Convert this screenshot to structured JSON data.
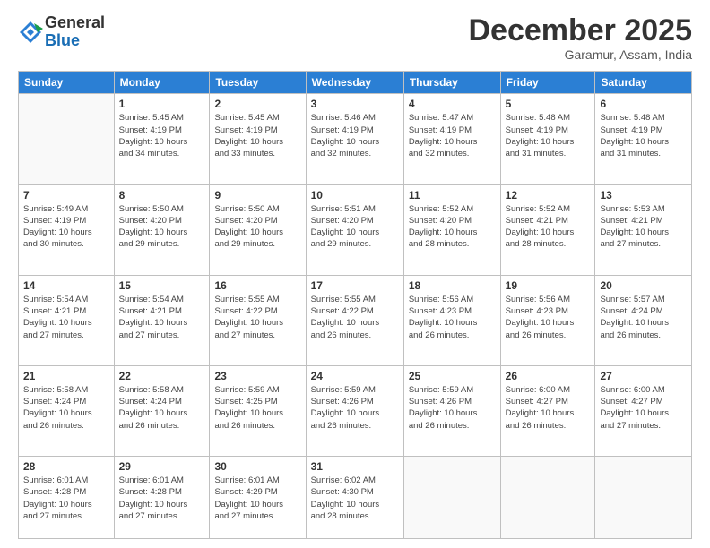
{
  "logo": {
    "general": "General",
    "blue": "Blue"
  },
  "header": {
    "month": "December 2025",
    "location": "Garamur, Assam, India"
  },
  "weekdays": [
    "Sunday",
    "Monday",
    "Tuesday",
    "Wednesday",
    "Thursday",
    "Friday",
    "Saturday"
  ],
  "weeks": [
    [
      {
        "day": "",
        "info": ""
      },
      {
        "day": "1",
        "info": "Sunrise: 5:45 AM\nSunset: 4:19 PM\nDaylight: 10 hours\nand 34 minutes."
      },
      {
        "day": "2",
        "info": "Sunrise: 5:45 AM\nSunset: 4:19 PM\nDaylight: 10 hours\nand 33 minutes."
      },
      {
        "day": "3",
        "info": "Sunrise: 5:46 AM\nSunset: 4:19 PM\nDaylight: 10 hours\nand 32 minutes."
      },
      {
        "day": "4",
        "info": "Sunrise: 5:47 AM\nSunset: 4:19 PM\nDaylight: 10 hours\nand 32 minutes."
      },
      {
        "day": "5",
        "info": "Sunrise: 5:48 AM\nSunset: 4:19 PM\nDaylight: 10 hours\nand 31 minutes."
      },
      {
        "day": "6",
        "info": "Sunrise: 5:48 AM\nSunset: 4:19 PM\nDaylight: 10 hours\nand 31 minutes."
      }
    ],
    [
      {
        "day": "7",
        "info": "Sunrise: 5:49 AM\nSunset: 4:19 PM\nDaylight: 10 hours\nand 30 minutes."
      },
      {
        "day": "8",
        "info": "Sunrise: 5:50 AM\nSunset: 4:20 PM\nDaylight: 10 hours\nand 29 minutes."
      },
      {
        "day": "9",
        "info": "Sunrise: 5:50 AM\nSunset: 4:20 PM\nDaylight: 10 hours\nand 29 minutes."
      },
      {
        "day": "10",
        "info": "Sunrise: 5:51 AM\nSunset: 4:20 PM\nDaylight: 10 hours\nand 29 minutes."
      },
      {
        "day": "11",
        "info": "Sunrise: 5:52 AM\nSunset: 4:20 PM\nDaylight: 10 hours\nand 28 minutes."
      },
      {
        "day": "12",
        "info": "Sunrise: 5:52 AM\nSunset: 4:21 PM\nDaylight: 10 hours\nand 28 minutes."
      },
      {
        "day": "13",
        "info": "Sunrise: 5:53 AM\nSunset: 4:21 PM\nDaylight: 10 hours\nand 27 minutes."
      }
    ],
    [
      {
        "day": "14",
        "info": "Sunrise: 5:54 AM\nSunset: 4:21 PM\nDaylight: 10 hours\nand 27 minutes."
      },
      {
        "day": "15",
        "info": "Sunrise: 5:54 AM\nSunset: 4:21 PM\nDaylight: 10 hours\nand 27 minutes."
      },
      {
        "day": "16",
        "info": "Sunrise: 5:55 AM\nSunset: 4:22 PM\nDaylight: 10 hours\nand 27 minutes."
      },
      {
        "day": "17",
        "info": "Sunrise: 5:55 AM\nSunset: 4:22 PM\nDaylight: 10 hours\nand 26 minutes."
      },
      {
        "day": "18",
        "info": "Sunrise: 5:56 AM\nSunset: 4:23 PM\nDaylight: 10 hours\nand 26 minutes."
      },
      {
        "day": "19",
        "info": "Sunrise: 5:56 AM\nSunset: 4:23 PM\nDaylight: 10 hours\nand 26 minutes."
      },
      {
        "day": "20",
        "info": "Sunrise: 5:57 AM\nSunset: 4:24 PM\nDaylight: 10 hours\nand 26 minutes."
      }
    ],
    [
      {
        "day": "21",
        "info": "Sunrise: 5:58 AM\nSunset: 4:24 PM\nDaylight: 10 hours\nand 26 minutes."
      },
      {
        "day": "22",
        "info": "Sunrise: 5:58 AM\nSunset: 4:24 PM\nDaylight: 10 hours\nand 26 minutes."
      },
      {
        "day": "23",
        "info": "Sunrise: 5:59 AM\nSunset: 4:25 PM\nDaylight: 10 hours\nand 26 minutes."
      },
      {
        "day": "24",
        "info": "Sunrise: 5:59 AM\nSunset: 4:26 PM\nDaylight: 10 hours\nand 26 minutes."
      },
      {
        "day": "25",
        "info": "Sunrise: 5:59 AM\nSunset: 4:26 PM\nDaylight: 10 hours\nand 26 minutes."
      },
      {
        "day": "26",
        "info": "Sunrise: 6:00 AM\nSunset: 4:27 PM\nDaylight: 10 hours\nand 26 minutes."
      },
      {
        "day": "27",
        "info": "Sunrise: 6:00 AM\nSunset: 4:27 PM\nDaylight: 10 hours\nand 27 minutes."
      }
    ],
    [
      {
        "day": "28",
        "info": "Sunrise: 6:01 AM\nSunset: 4:28 PM\nDaylight: 10 hours\nand 27 minutes."
      },
      {
        "day": "29",
        "info": "Sunrise: 6:01 AM\nSunset: 4:28 PM\nDaylight: 10 hours\nand 27 minutes."
      },
      {
        "day": "30",
        "info": "Sunrise: 6:01 AM\nSunset: 4:29 PM\nDaylight: 10 hours\nand 27 minutes."
      },
      {
        "day": "31",
        "info": "Sunrise: 6:02 AM\nSunset: 4:30 PM\nDaylight: 10 hours\nand 28 minutes."
      },
      {
        "day": "",
        "info": ""
      },
      {
        "day": "",
        "info": ""
      },
      {
        "day": "",
        "info": ""
      }
    ]
  ]
}
